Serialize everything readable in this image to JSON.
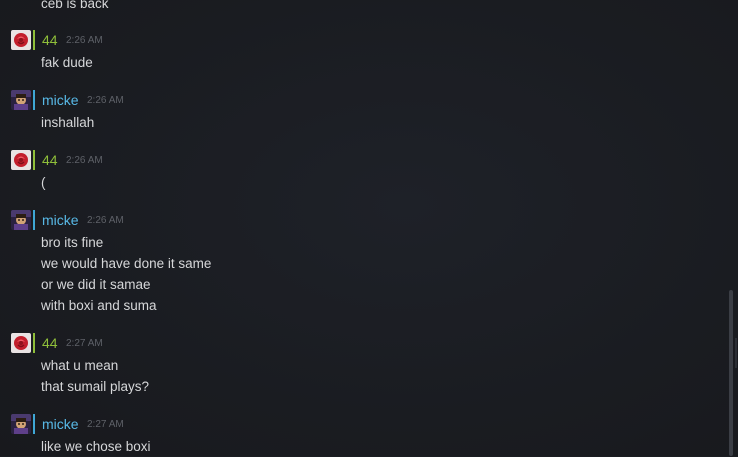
{
  "colors": {
    "user_44": "#8fbf3a",
    "user_micke": "#58b9e6",
    "status_44": "#8fbf3a",
    "status_micke": "#3fa7d6"
  },
  "top_fragment": "ceb is back",
  "messages": [
    {
      "user": "44",
      "avatar": "rose-avatar-icon",
      "time": "2:26 AM",
      "lines": [
        "fak dude"
      ]
    },
    {
      "user": "micke",
      "avatar": "character-avatar-icon",
      "time": "2:26 AM",
      "lines": [
        "inshallah"
      ]
    },
    {
      "user": "44",
      "avatar": "rose-avatar-icon",
      "time": "2:26 AM",
      "lines": [
        "("
      ]
    },
    {
      "user": "micke",
      "avatar": "character-avatar-icon",
      "time": "2:26 AM",
      "lines": [
        "bro its fine",
        "we would have done it same",
        "or we did it samae",
        "with boxi and suma"
      ]
    },
    {
      "user": "44",
      "avatar": "rose-avatar-icon",
      "time": "2:27 AM",
      "lines": [
        "what u mean",
        "that sumail plays?"
      ]
    },
    {
      "user": "micke",
      "avatar": "character-avatar-icon",
      "time": "2:27 AM",
      "lines": [
        "like we chose boxi"
      ]
    }
  ]
}
